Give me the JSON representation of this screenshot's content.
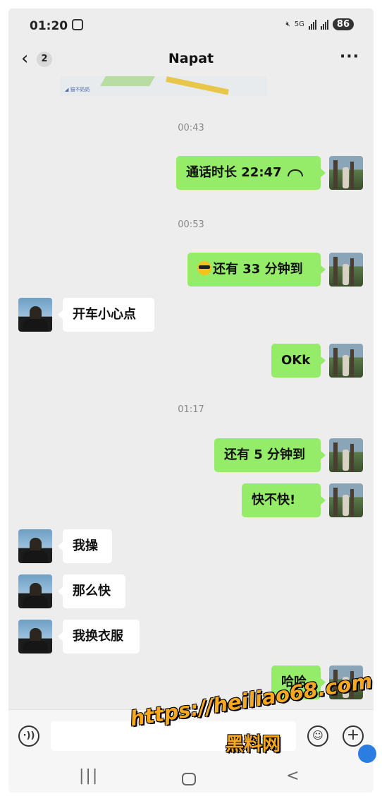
{
  "status": {
    "time": "01:20",
    "battery": "86",
    "network": "5G"
  },
  "header": {
    "back_symbol": "‹",
    "unread": "2",
    "title": "Napat",
    "more": "···"
  },
  "map": {
    "label": "◢ 猫不奶奶"
  },
  "timestamps": [
    "00:43",
    "00:53",
    "01:17"
  ],
  "messages": [
    {
      "from": "me",
      "text": "通话时长 22:47",
      "icon": "phone-hangup-icon"
    },
    {
      "from": "me",
      "text": "还有 33 分钟到",
      "icon": "sunglasses-emoji"
    },
    {
      "from": "other",
      "text": "开车小心点"
    },
    {
      "from": "me",
      "text": "OKk"
    },
    {
      "from": "me",
      "text": "还有 5 分钟到"
    },
    {
      "from": "me",
      "text": "快不快!"
    },
    {
      "from": "other",
      "text": "我操"
    },
    {
      "from": "other",
      "text": "那么快"
    },
    {
      "from": "other",
      "text": "我换衣服"
    },
    {
      "from": "me",
      "text": "哈哈"
    }
  ],
  "input": {
    "voice_symbol": "·))",
    "emoji_symbol": "☺",
    "plus_symbol": "+"
  },
  "nav": {
    "recent": "|||",
    "back": "<"
  },
  "watermark": {
    "url": "https://heiliao68.com",
    "text": "黑料网"
  }
}
